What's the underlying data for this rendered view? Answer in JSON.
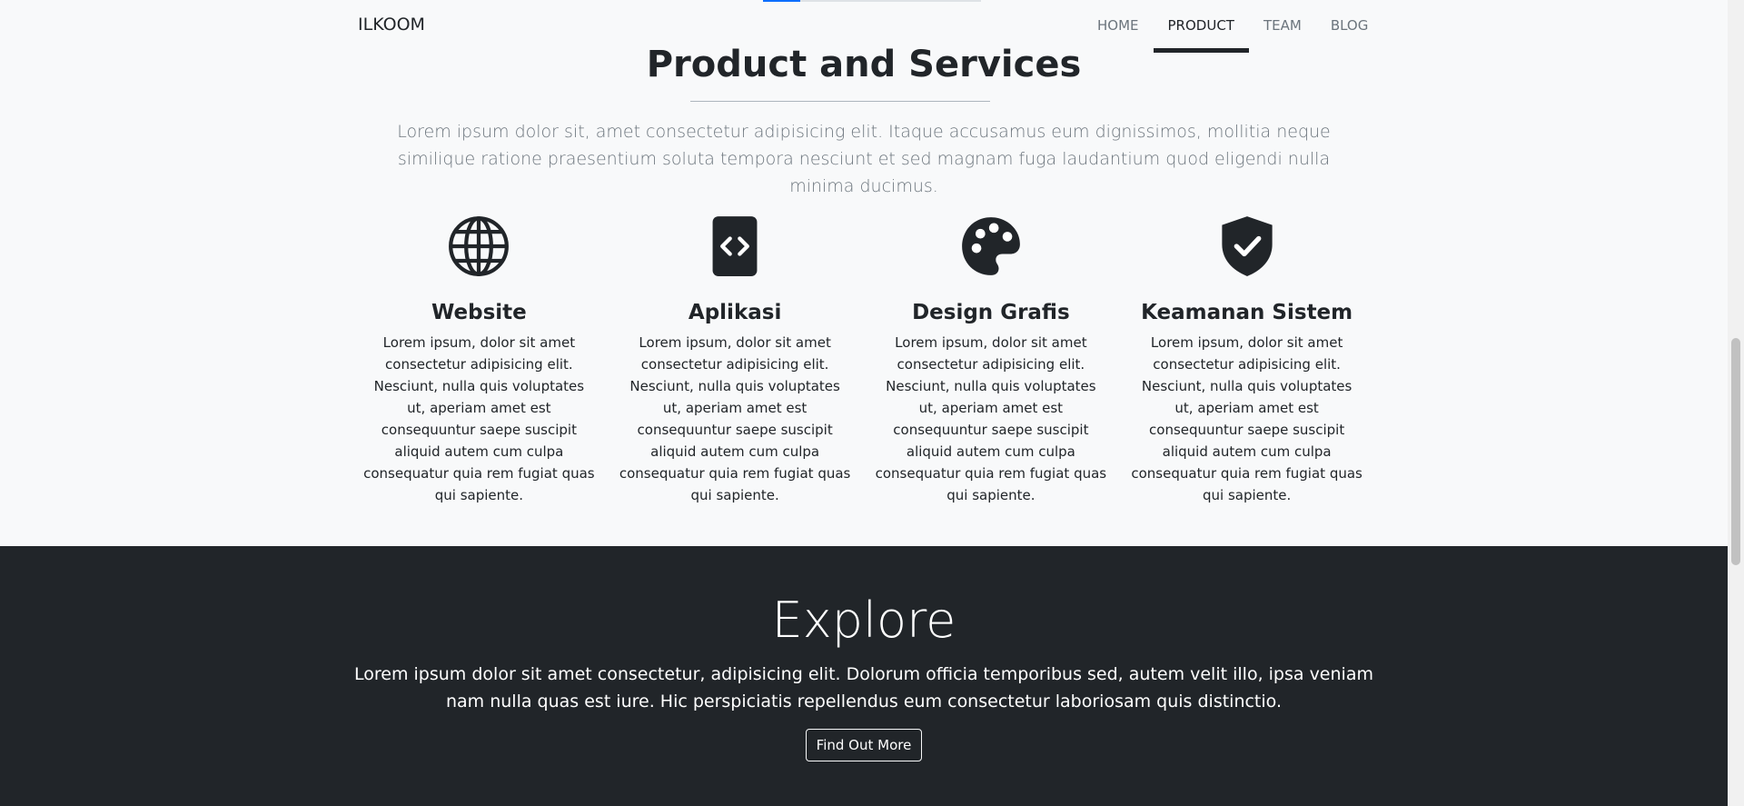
{
  "navbar": {
    "brand": "ILKOOM",
    "links": [
      {
        "label": "HOME",
        "active": false
      },
      {
        "label": "PRODUCT",
        "active": true
      },
      {
        "label": "TEAM",
        "active": false
      },
      {
        "label": "BLOG",
        "active": false
      }
    ]
  },
  "product": {
    "title": "Product and Services",
    "description": "Lorem ipsum dolor sit, amet consectetur adipisicing elit. Itaque accusamus eum dignissimos, mollitia neque similique ratione praesentium soluta tempora nesciunt et sed magnam fuga laudantium quod eligendi nulla minima ducimus.",
    "services": [
      {
        "icon": "globe-icon",
        "title": "Website",
        "text": "Lorem ipsum, dolor sit amet consectetur adipisicing elit. Nesciunt, nulla quis voluptates ut, aperiam amet est consequuntur saepe suscipit aliquid autem cum culpa consequatur quia rem fugiat quas qui sapiente."
      },
      {
        "icon": "code-file-icon",
        "title": "Aplikasi",
        "text": "Lorem ipsum, dolor sit amet consectetur adipisicing elit. Nesciunt, nulla quis voluptates ut, aperiam amet est consequuntur saepe suscipit aliquid autem cum culpa consequatur quia rem fugiat quas qui sapiente."
      },
      {
        "icon": "palette-icon",
        "title": "Design Grafis",
        "text": "Lorem ipsum, dolor sit amet consectetur adipisicing elit. Nesciunt, nulla quis voluptates ut, aperiam amet est consequuntur saepe suscipit aliquid autem cum culpa consequatur quia rem fugiat quas qui sapiente."
      },
      {
        "icon": "shield-check-icon",
        "title": "Keamanan Sistem",
        "text": "Lorem ipsum, dolor sit amet consectetur adipisicing elit. Nesciunt, nulla quis voluptates ut, aperiam amet est consequuntur saepe suscipit aliquid autem cum culpa consequatur quia rem fugiat quas qui sapiente."
      }
    ]
  },
  "explore": {
    "title": "Explore",
    "text": "Lorem ipsum dolor sit amet consectetur, adipisicing elit. Dolorum officia temporibus sed, autem velit illo, ipsa veniam nam nulla quas est iure. Hic perspiciatis repellendus eum consectetur laboriosam quis distinctio.",
    "button_label": "Find Out More"
  },
  "colors": {
    "dark": "#212529",
    "light": "#f8f9fa",
    "muted": "#6c757d",
    "progress_accent": "#0d6efd"
  },
  "scroll_progress": 0.17
}
